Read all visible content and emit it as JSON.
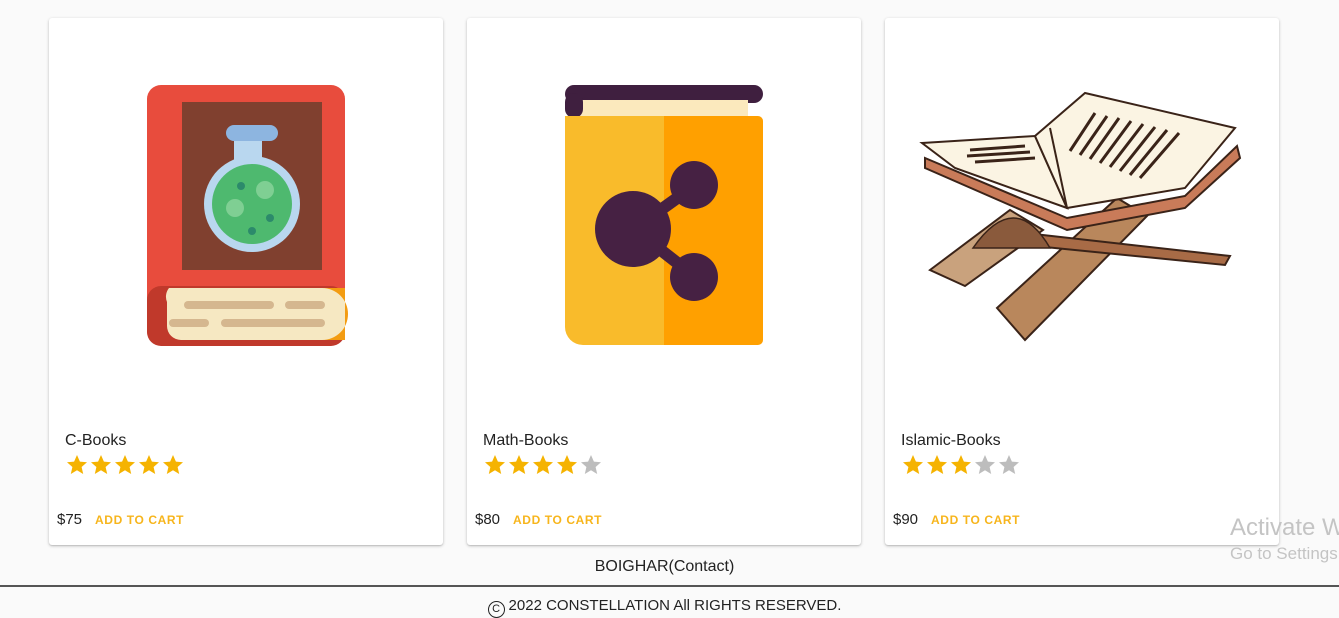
{
  "products": [
    {
      "name": "C-Books",
      "price": "$75",
      "rating": 5,
      "max_rating": 5,
      "cta": "ADD TO CART",
      "image_icon": "science-book-icon"
    },
    {
      "name": "Math-Books",
      "price": "$80",
      "rating": 4,
      "max_rating": 5,
      "cta": "ADD TO CART",
      "image_icon": "share-book-icon"
    },
    {
      "name": "Islamic-Books",
      "price": "$90",
      "rating": 3,
      "max_rating": 5,
      "cta": "ADD TO CART",
      "image_icon": "quran-stand-icon"
    }
  ],
  "footer": {
    "contact": "BOIGHAR(Contact)",
    "copyright_symbol": "C",
    "copyright": "2022 CONSTELLATION All RIGHTS RESERVED."
  },
  "watermark": {
    "title": "Activate W",
    "subtitle": "Go to Settings"
  },
  "colors": {
    "star_filled": "#f5b301",
    "star_empty": "#bdbdbd",
    "accent": "#f7b51c"
  }
}
